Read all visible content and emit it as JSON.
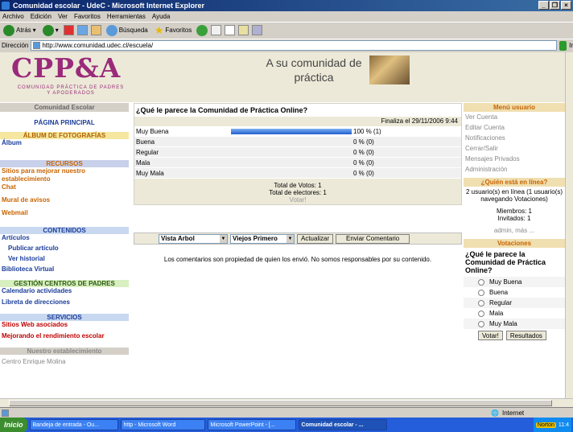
{
  "window": {
    "title": "Comunidad escolar - UdeC - Microsoft Internet Explorer",
    "min": "_",
    "max": "❐",
    "close": "×"
  },
  "menu": [
    "Archivo",
    "Edición",
    "Ver",
    "Favoritos",
    "Herramientas",
    "Ayuda"
  ],
  "toolbar": {
    "back": "Atrás",
    "search": "Búsqueda",
    "favorites": "Favoritos"
  },
  "address": {
    "label": "Dirección",
    "url": "http://www.comunidad.udec.cl/escuela/",
    "go": "Ir"
  },
  "header": {
    "logo": "CPP&A",
    "logo_sub": "COMUNIDAD PRÁCTICA DE PADRES Y APODERADOS",
    "tagline": "A su comunidad de práctica"
  },
  "leftnav": {
    "title": "Comunidad Escolar",
    "home": "PÁGINA PRINCIPAL",
    "album_title": "ÁLBUM DE FOTOGRAFÍAS",
    "album": "Álbum",
    "recursos_title": "RECURSOS",
    "recursos": [
      "Sitios para mejorar nuestro establecimiento",
      "Chat",
      "Mural de avisos",
      "Webmail"
    ],
    "contenidos_title": "CONTENIDOS",
    "contenidos": [
      "Artículos",
      "Publicar artículo",
      "Ver historial",
      "Biblioteca Virtual"
    ],
    "gestion_title": "GESTIÓN CENTROS DE PADRES",
    "gestion": [
      "Calendario actividades",
      "Libreta de direcciones"
    ],
    "servicios_title": "SERVICIOS",
    "servicios": [
      "Sitios Web asociados",
      "Mejorando el rendimiento escolar"
    ],
    "estab_title": "Nuestro establecimiento",
    "estab": "Centro Enrique Molina"
  },
  "poll": {
    "question": "¿Qué le parece la Comunidad de Práctica Online?",
    "ends": "Finaliza el 29/11/2006 9:44",
    "options": [
      {
        "label": "Muy Buena",
        "pct": "100 % (1)",
        "share": 1
      },
      {
        "label": "Buena",
        "pct": "0 % (0)",
        "share": 0
      },
      {
        "label": "Regular",
        "pct": "0 % (0)",
        "share": 0
      },
      {
        "label": "Mala",
        "pct": "0 % (0)",
        "share": 0
      },
      {
        "label": "Muy Mala",
        "pct": "0 % (0)",
        "share": 0
      }
    ],
    "total_votes": "Total de Votos: 1",
    "total_voters": "Total de electores: 1",
    "vote_link": "Votar!"
  },
  "comments": {
    "view": "Vista Arbol",
    "order": "Viejos Primero",
    "refresh": "Actualizar",
    "send": "Enviar Comentario",
    "disclaimer": "Los comentarios son propiedad de quien los envió. No somos responsables por su contenido."
  },
  "usermenu": {
    "title": "Menú usuario",
    "items": [
      "Ver Cuenta",
      "Editar Cuenta",
      "Notificaciones",
      "Cerrar/Salir",
      "Mensajes Privados",
      "Administración"
    ]
  },
  "online": {
    "title": "¿Quién está en línea?",
    "line1": "2 usuario(s) en línea (1 usuario(s) navegando Votaciones)",
    "members": "Miembros: 1",
    "guests": "Invitados: 1",
    "more": "admin, más ..."
  },
  "votes": {
    "title": "Votaciones",
    "question": "¿Qué le parece la Comunidad de Práctica Online?",
    "options": [
      "Muy Buena",
      "Buena",
      "Regular",
      "Mala",
      "Muy Mala"
    ],
    "vote_btn": "Votar!",
    "results_btn": "Resultados"
  },
  "status": {
    "zone": "Internet"
  },
  "taskbar": {
    "start": "Inicio",
    "tasks": [
      "Bandeja de entrada - Ou...",
      "http - Microsoft Word",
      "Microsoft PowerPoint - [...",
      "Comunidad escolar - ..."
    ],
    "norton": "Norton",
    "clock": "11:4"
  }
}
